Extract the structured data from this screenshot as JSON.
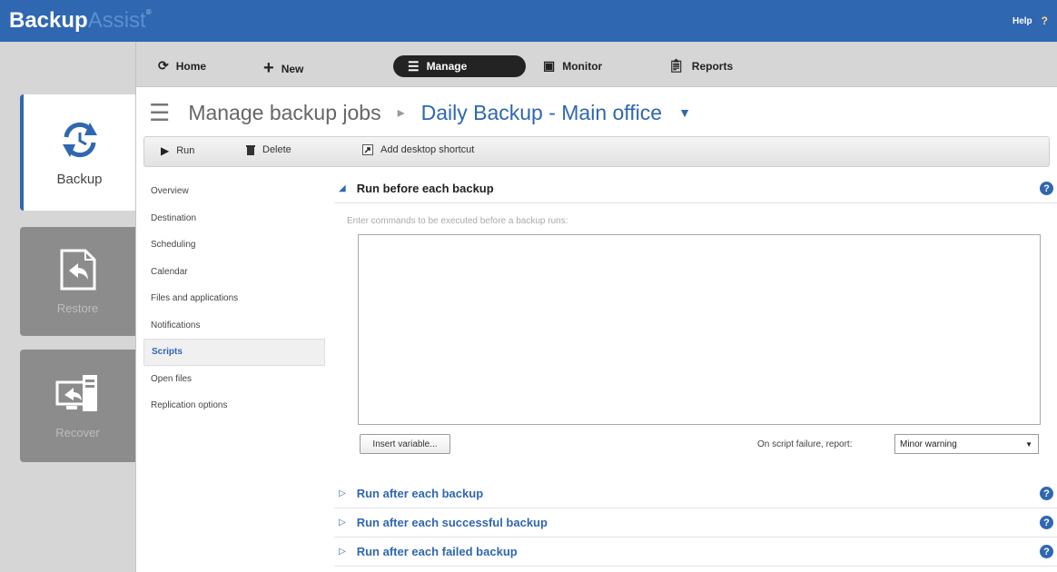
{
  "app": {
    "name_part1": "Backup",
    "name_part2": "Assist",
    "trademark": "®",
    "help_label": "Help",
    "help_icon": "?"
  },
  "rail": [
    {
      "label": "Backup",
      "active": true
    },
    {
      "label": "Restore",
      "active": false
    },
    {
      "label": "Recover",
      "active": false
    }
  ],
  "nav": {
    "home": "Home",
    "new": "New",
    "manage": "Manage",
    "monitor": "Monitor",
    "reports": "Reports"
  },
  "page": {
    "section": "Manage backup jobs",
    "job": "Daily Backup - Main office"
  },
  "toolbar": {
    "run": "Run",
    "delete": "Delete",
    "shortcut": "Add desktop shortcut"
  },
  "subnav": [
    "Overview",
    "Destination",
    "Scheduling",
    "Calendar",
    "Files and applications",
    "Notifications",
    "Scripts",
    "Open files",
    "Replication options"
  ],
  "subnav_active_index": 6,
  "scripts": {
    "before": {
      "title": "Run before each backup",
      "instruction": "Enter commands to be executed before a backup runs:",
      "command_value": "",
      "insert_label": "Insert variable...",
      "failure_label": "On script failure, report:",
      "failure_value": "Minor warning"
    },
    "after": {
      "title": "Run after each backup"
    },
    "after_success": {
      "title": "Run after each successful backup"
    },
    "after_failed": {
      "title": "Run after each failed backup"
    }
  },
  "colors": {
    "accent": "#2f67b1",
    "rail_bg": "#d6d6d6",
    "tile_inactive": "#8c8c8c"
  }
}
